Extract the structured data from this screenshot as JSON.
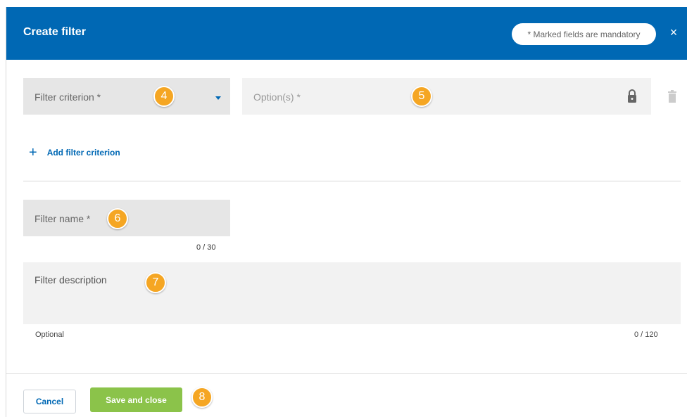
{
  "header": {
    "title": "Create filter",
    "mandatory_note": "* Marked fields are mandatory",
    "close_icon": "×"
  },
  "criterion": {
    "select_label": "Filter criterion *",
    "options_label": "Option(s) *",
    "add_label": "Add filter criterion",
    "add_icon": "+"
  },
  "name": {
    "label": "Filter name *",
    "counter": "0 / 30"
  },
  "description": {
    "label": "Filter description",
    "hint": "Optional",
    "counter": "0 / 120"
  },
  "footer": {
    "cancel_label": "Cancel",
    "save_label": "Save and close"
  },
  "callouts": [
    "4",
    "5",
    "6",
    "7",
    "8"
  ],
  "colors": {
    "brand": "#0068b4",
    "primary_button": "#8bc34a",
    "callout": "#f5a623"
  },
  "icons": [
    "close-icon",
    "chevron-down-icon",
    "lock-icon",
    "trash-icon",
    "plus-icon"
  ]
}
